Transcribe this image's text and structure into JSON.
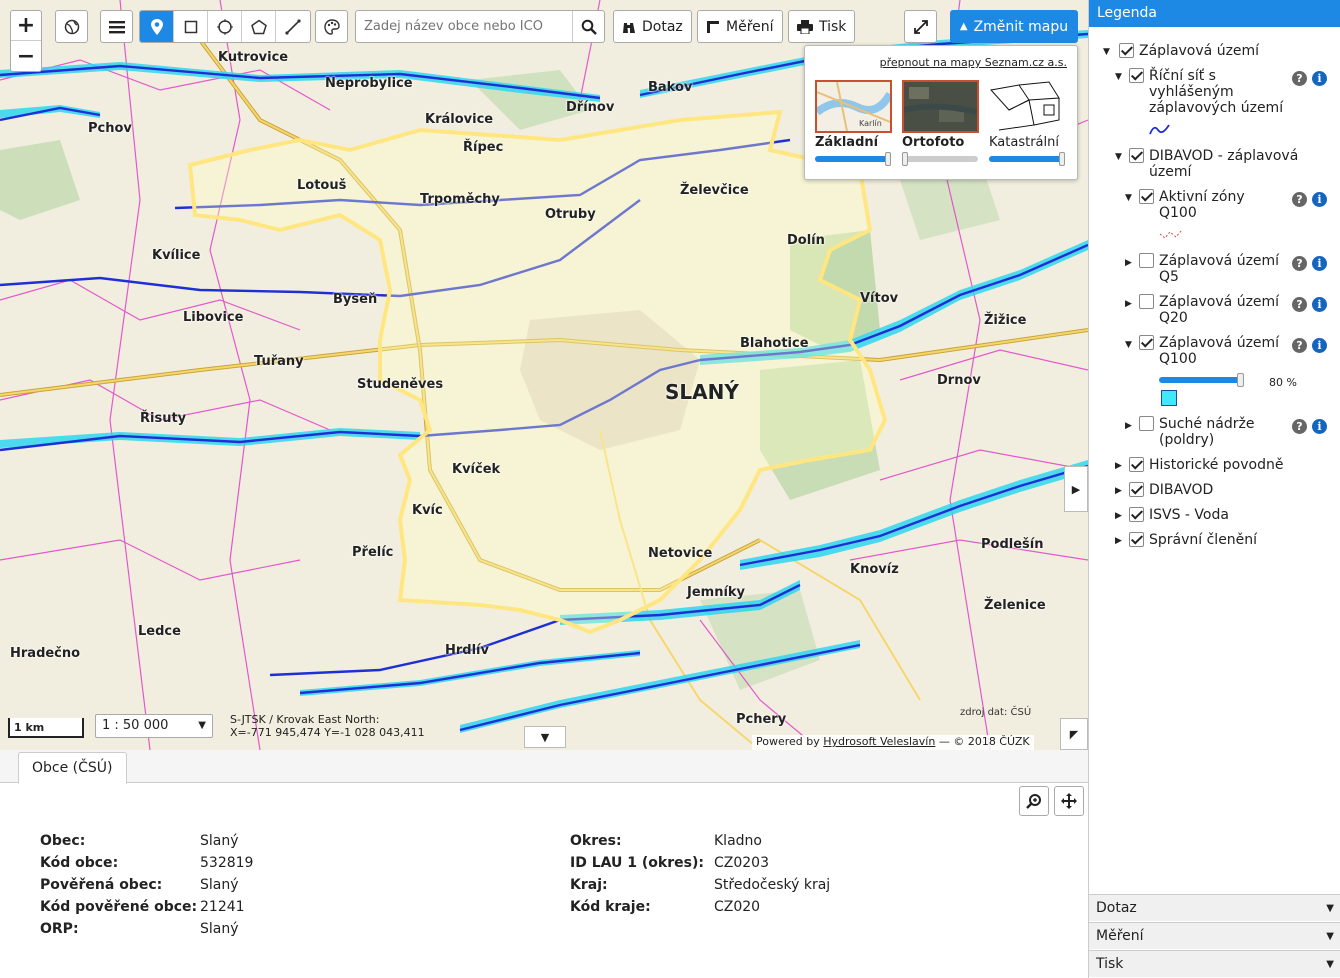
{
  "toolbar": {
    "zoom_in": "+",
    "zoom_out": "−",
    "search_placeholder": "Zadej název obce nebo ICO",
    "query_label": "Dotaz",
    "measure_label": "Měření",
    "print_label": "Tisk",
    "change_map_label": "Změnit mapu"
  },
  "basemaps": {
    "switch_link": "přepnout na mapy Seznam.cz a.s.",
    "items": [
      {
        "label": "Základní",
        "thumb_text": "Karlín",
        "opacity_pct": 100
      },
      {
        "label": "Ortofoto",
        "opacity_pct": 0
      },
      {
        "label": "Katastrální",
        "opacity_pct": 100
      }
    ]
  },
  "map": {
    "scale_bar": "1 km",
    "scale_select": "1 : 50 000",
    "coords_line1": "S-JTSK / Krovak East North:",
    "coords_line2": "X=-771 945,474 Y=-1 028 043,411",
    "attribution_prefix": "Powered by",
    "attribution_link": "Hydrosoft Veleslavín",
    "attribution_suffix": "— © 2018 ČÚZK",
    "data_source": "zdroj dat: ČSÚ",
    "places": [
      {
        "name": "Kutrovice"
      },
      {
        "name": "Neprobylice"
      },
      {
        "name": "Bakov"
      },
      {
        "name": "Pchov"
      },
      {
        "name": "Královice"
      },
      {
        "name": "Dřínov"
      },
      {
        "name": "Řípec"
      },
      {
        "name": "Lotouš"
      },
      {
        "name": "Trpoměchy"
      },
      {
        "name": "Želevčice"
      },
      {
        "name": "Otruby"
      },
      {
        "name": "Dolín"
      },
      {
        "name": "Kvílice"
      },
      {
        "name": "Libovice"
      },
      {
        "name": "Byseň"
      },
      {
        "name": "Vítov"
      },
      {
        "name": "Žižice"
      },
      {
        "name": "Tuřany"
      },
      {
        "name": "Studeněves"
      },
      {
        "name": "Blahotice"
      },
      {
        "name": "SLANÝ"
      },
      {
        "name": "Drnov"
      },
      {
        "name": "Řisuty"
      },
      {
        "name": "Kvíček"
      },
      {
        "name": "Kvíc"
      },
      {
        "name": "Netovice"
      },
      {
        "name": "Přelíc"
      },
      {
        "name": "Ledce"
      },
      {
        "name": "Jemníky"
      },
      {
        "name": "Knovíz"
      },
      {
        "name": "Podlešín"
      },
      {
        "name": "Želenice"
      },
      {
        "name": "Hradečno"
      },
      {
        "name": "Hrdlív"
      },
      {
        "name": "Pchery"
      }
    ]
  },
  "bottom_panel": {
    "tab_label": "Obce (ČSÚ)",
    "left": [
      {
        "key": "Obec",
        "value": "Slaný"
      },
      {
        "key": "Kód obce",
        "value": "532819"
      },
      {
        "key": "Pověřená obec",
        "value": "Slaný"
      },
      {
        "key": "Kód pověřené obce",
        "value": "21241"
      },
      {
        "key": "ORP",
        "value": "Slaný"
      }
    ],
    "right": [
      {
        "key": "Okres",
        "value": "Kladno"
      },
      {
        "key": "ID LAU 1 (okres)",
        "value": "CZ0203"
      },
      {
        "key": "Kraj",
        "value": "Středočeský kraj"
      },
      {
        "key": "Kód kraje",
        "value": "CZ020"
      }
    ]
  },
  "legend": {
    "title": "Legenda",
    "root": "Záplavová území",
    "river_network_l1": "Říční síť s",
    "river_network_l2": "vyhlášeným",
    "river_network_l3": "záplavových území",
    "dibavod_zu_l1": "DIBAVOD - záplavová",
    "dibavod_zu_l2": "území",
    "active_zones_l1": "Aktivní zóny",
    "active_zones_l2": "Q100",
    "q5_l1": "Záplavová území",
    "q5_l2": "Q5",
    "q20_l1": "Záplavová území",
    "q20_l2": "Q20",
    "q100_l1": "Záplavová území",
    "q100_l2": "Q100",
    "q100_opacity": "80 %",
    "dry_tanks_l1": "Suché nádrže",
    "dry_tanks_l2": "(poldry)",
    "historical": "Historické povodně",
    "dibavod": "DIBAVOD",
    "isvs": "ISVS - Voda",
    "admin": "Správní členění",
    "q": "?",
    "i": "i"
  },
  "accordion": {
    "query": "Dotaz",
    "measure": "Měření",
    "print": "Tisk"
  },
  "colors": {
    "accent": "#1e88e5",
    "river": "#1f2fd6",
    "flood": "#2fd6f0",
    "boundary": "#ffe680",
    "admin_lines": "#e040c8"
  }
}
